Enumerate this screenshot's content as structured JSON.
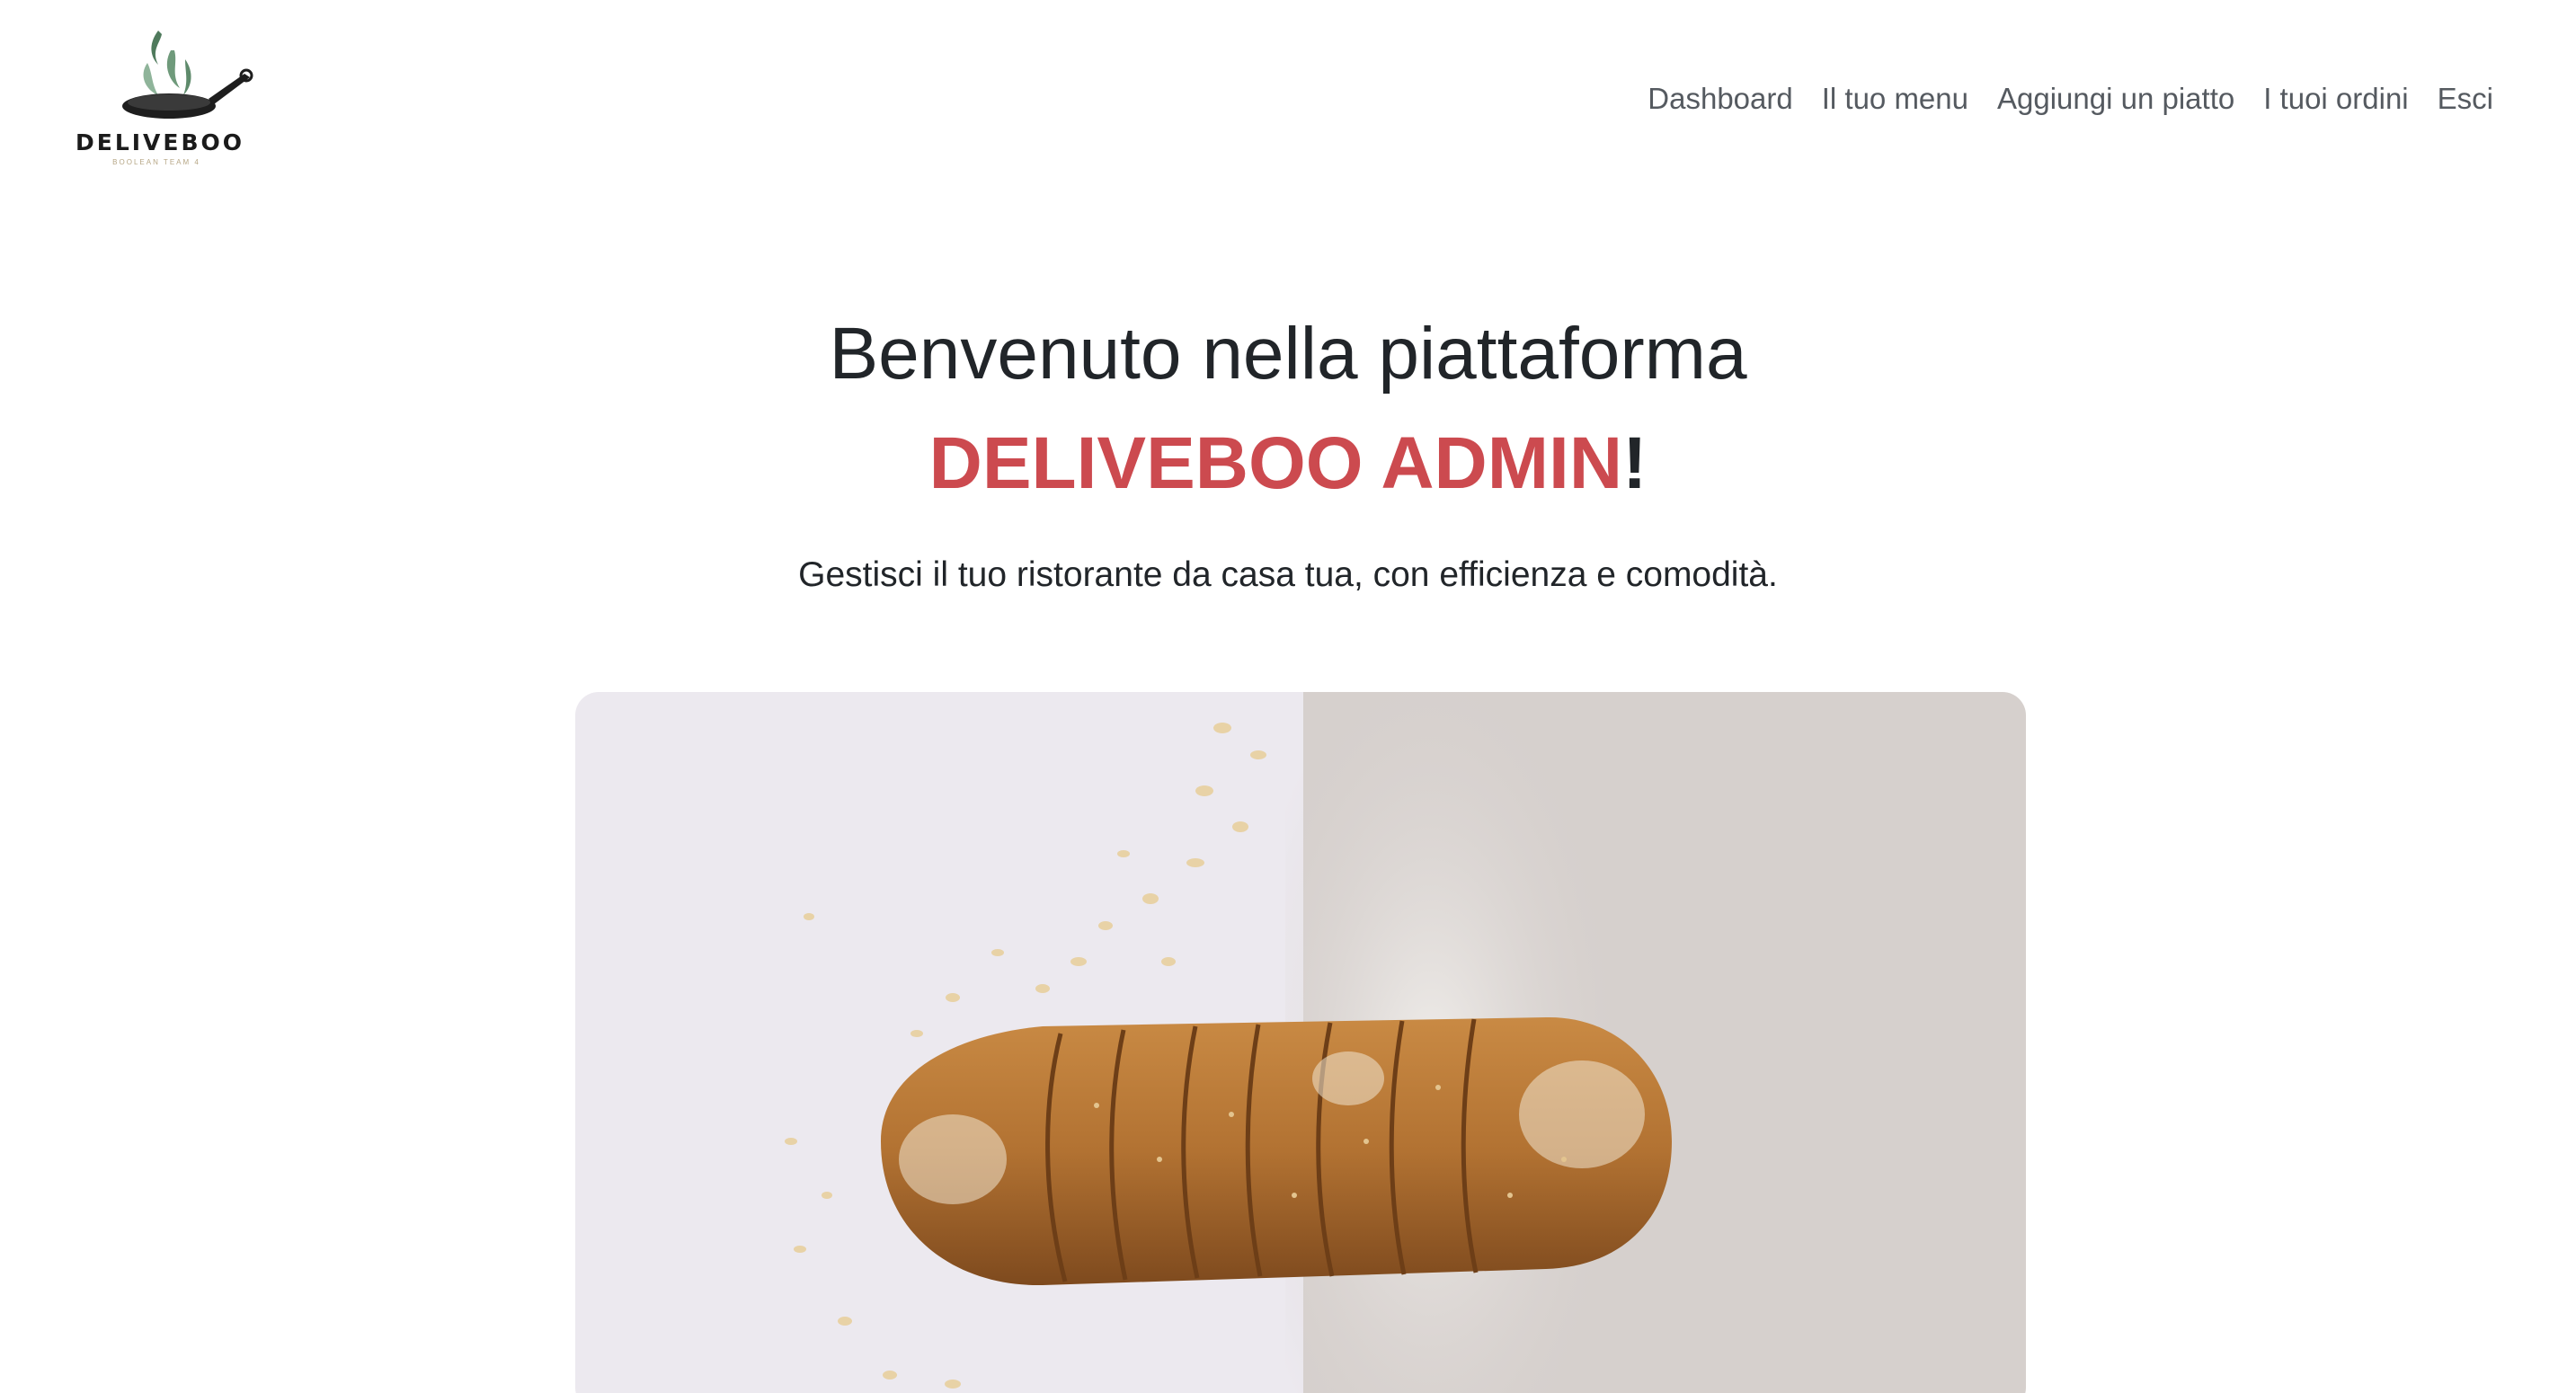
{
  "brand": {
    "logo_text": "DELIVEBOO",
    "logo_subtext": "BOOLEAN TEAM 4"
  },
  "nav": {
    "items": [
      {
        "label": "Dashboard"
      },
      {
        "label": "Il tuo menu"
      },
      {
        "label": "Aggiungi un piatto"
      },
      {
        "label": "I tuoi ordini"
      },
      {
        "label": "Esci"
      }
    ]
  },
  "hero": {
    "title_line1": "Benvenuto nella piattaforma",
    "title_highlight": "DELIVEBOO ADMIN",
    "title_suffix": "!",
    "subtitle": "Gestisci il tuo ristorante da casa tua, con efficienza e comodità."
  },
  "colors": {
    "accent": "#cc4a4f",
    "text": "#212529",
    "nav_text": "#555a60"
  },
  "icons": {
    "logo": "pan-with-steam-icon",
    "hero_image": "sliced-bread-photo"
  }
}
